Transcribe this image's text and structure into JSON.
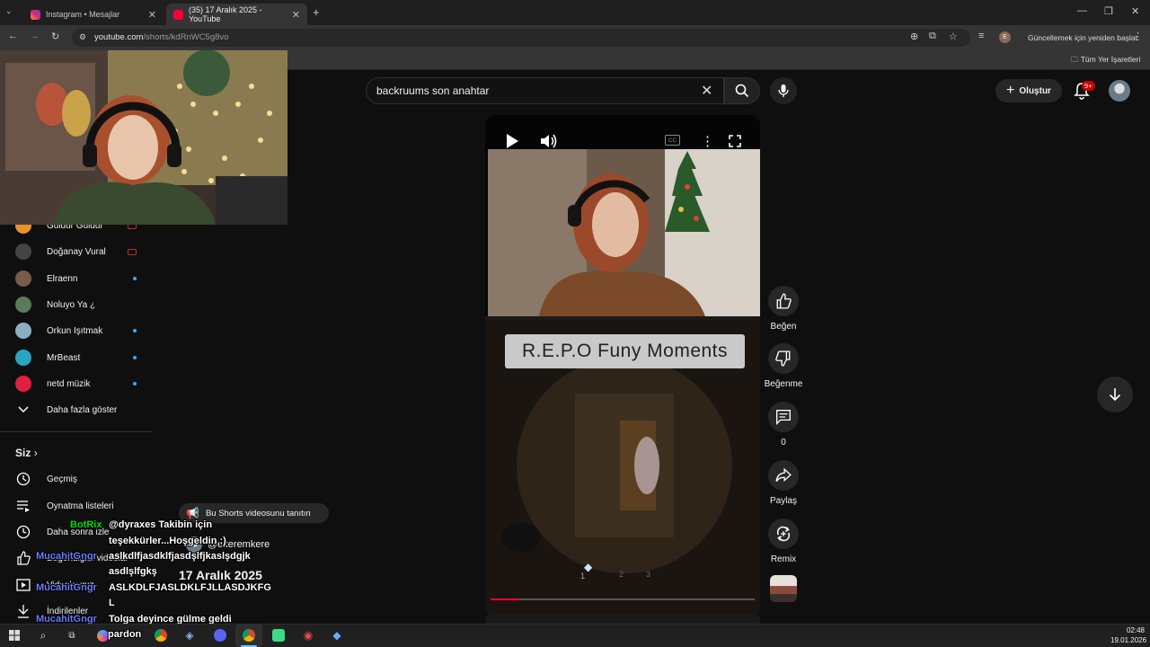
{
  "browser": {
    "tabs": [
      {
        "title": "Instagram • Mesajlar",
        "active": false
      },
      {
        "title": "(35) 17 Aralık 2025 - YouTube",
        "active": true
      }
    ],
    "url_host": "youtube.com",
    "url_path": "/shorts/kdRnWC5g8vo",
    "relaunch_label": "Güncellemek için yeniden başlat",
    "profile_initial": "E",
    "bookmarks_all": "Tüm Yer İşaretleri"
  },
  "youtube": {
    "search_value": "backruums son anahtar",
    "create_label": "Oluştur",
    "notifications_badge": "9+"
  },
  "sidebar": {
    "subscriptions": [
      {
        "name": "Guldur Guldur",
        "indicator": "live-red",
        "avatar_color": "#e8912d"
      },
      {
        "name": "Doğanay Vural",
        "indicator": "live-red",
        "avatar_color": "#444444"
      },
      {
        "name": "Elraenn",
        "indicator": "dot",
        "avatar_color": "#7a5a4a"
      },
      {
        "name": "Noluyo Ya ¿",
        "indicator": "none",
        "avatar_color": "#5a7a5a"
      },
      {
        "name": "Orkun Işıtmak",
        "indicator": "dot",
        "avatar_color": "#8ab0c0"
      },
      {
        "name": "MrBeast",
        "indicator": "dot",
        "avatar_color": "#2aa4c0"
      },
      {
        "name": "netd müzik",
        "indicator": "dot",
        "avatar_color": "#e02040"
      }
    ],
    "show_more": "Daha fazla göster",
    "you_heading": "Siz",
    "you_items": [
      {
        "label": "Geçmiş",
        "icon": "history-icon"
      },
      {
        "label": "Oynatma listeleri",
        "icon": "playlist-icon"
      },
      {
        "label": "Daha sonra izle",
        "icon": "watch-later-icon"
      },
      {
        "label": "Beğendiğim videolar",
        "icon": "like-icon"
      },
      {
        "label": "Videolarınız",
        "icon": "your-videos-icon"
      },
      {
        "label": "İndirilenler",
        "icon": "download-icon"
      }
    ]
  },
  "short": {
    "banner_text": "R.E.P.O Funy Moments",
    "progress": 0.11,
    "dots": [
      "1",
      "2",
      "3"
    ],
    "promote_tooltip": "Bu Shorts videosunu tanıtın",
    "channel_handle": "@ekeremkere",
    "video_title": "17 Aralık 2025"
  },
  "actions": [
    {
      "label": "Beğen",
      "icon": "thumb-up-icon"
    },
    {
      "label": "Beğenme",
      "icon": "thumb-down-icon"
    },
    {
      "label": "0",
      "icon": "comment-icon"
    },
    {
      "label": "Paylaş",
      "icon": "share-icon"
    },
    {
      "label": "Remix",
      "icon": "remix-icon"
    }
  ],
  "chat": [
    {
      "user": "BotRix",
      "lines": [
        "@dyraxes Takibin için",
        "teşekkürler...Hoşgeldin :)"
      ]
    },
    {
      "user": "MucahitGngr",
      "lines": [
        "aslkdlfjasdklfjasdşlfjkaslşdgjk",
        "asdlşlfgkş"
      ]
    },
    {
      "user": "MucahitGngr",
      "lines": [
        "ASLKDLFJASLDKLFJLLASDJKFG",
        "L"
      ]
    },
    {
      "user": "MucahitGngr",
      "lines": [
        "Tolga deyince gülme geldi"
      ]
    }
  ],
  "chat_tail": "pardon",
  "taskbar": {
    "time": "02:48",
    "date": "19.01.2026"
  }
}
